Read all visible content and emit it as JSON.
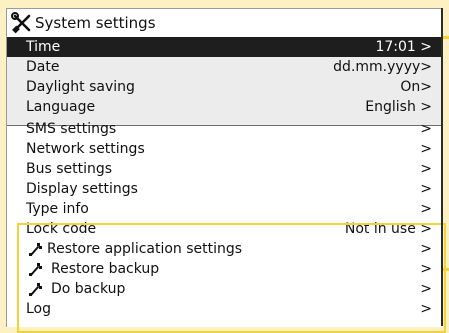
{
  "window": {
    "title": "System settings",
    "title_icon": "tools-icon"
  },
  "submenu": [
    {
      "label": "Time",
      "value": "17:01 >",
      "selected": true
    },
    {
      "label": "Date",
      "value": "dd.mm.yyyy>"
    },
    {
      "label": "Daylight saving",
      "value": "On>"
    },
    {
      "label": "Language",
      "value": "English >"
    }
  ],
  "menu": [
    {
      "label": "SMS settings",
      "value": ">"
    },
    {
      "label": "Network settings",
      "value": ">"
    },
    {
      "label": "Bus settings",
      "value": ">"
    },
    {
      "label": "Display settings",
      "value": ">"
    },
    {
      "label": "Type info",
      "value": ">"
    },
    {
      "label": "Lock code",
      "value": "Not in use >"
    },
    {
      "label": "Restore application settings",
      "value": ">",
      "icon": "wrench-icon"
    },
    {
      "label": "Restore backup",
      "value": ">",
      "icon": "wrench-icon"
    },
    {
      "label": "Do backup",
      "value": ">",
      "icon": "wrench-icon"
    },
    {
      "label": "Log",
      "value": ">"
    }
  ],
  "colors": {
    "background": "#fdf1c4",
    "selected_row": "#1e1e1e",
    "submenu_bg": "#ececec",
    "highlight": "#f3d33a"
  }
}
